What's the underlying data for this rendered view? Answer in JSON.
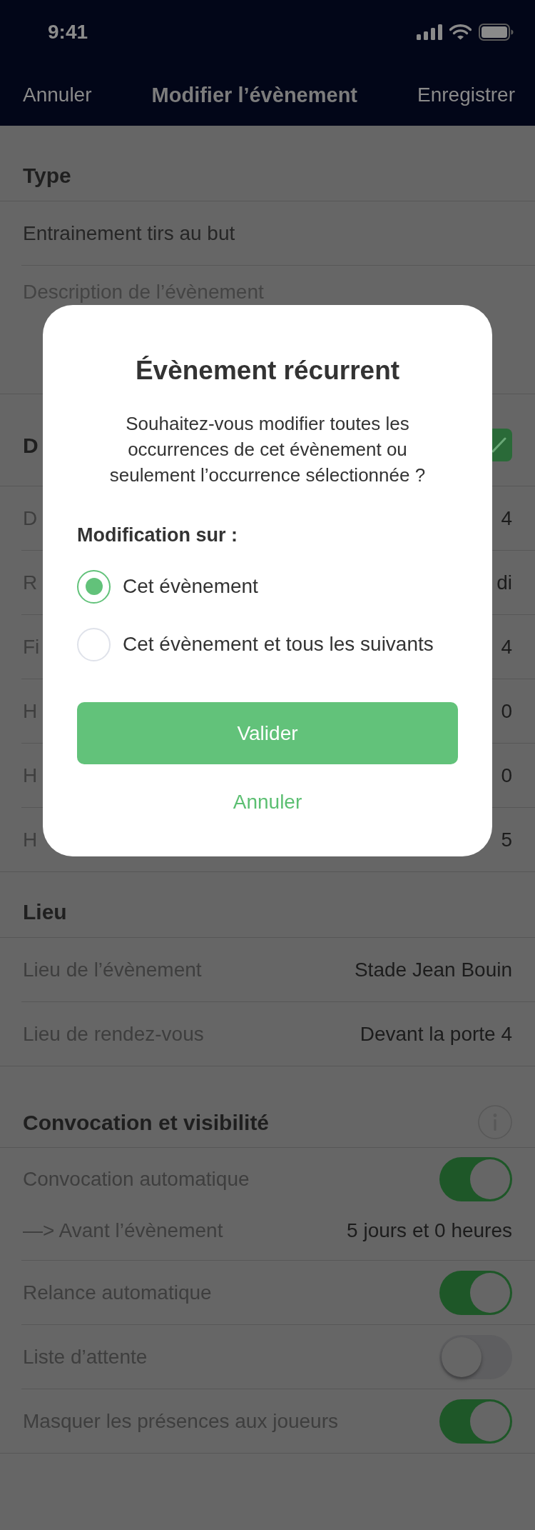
{
  "status_bar": {
    "time": "9:41"
  },
  "nav_bar": {
    "left_button": "Annuler",
    "title": "Modifier l’évènement",
    "right_button": "Enregistrer"
  },
  "sections": [
    {
      "kind": "plain",
      "title": "Type",
      "rows": [
        {
          "kind": "input",
          "value": "Entrainement tirs au but"
        },
        {
          "kind": "textarea",
          "placeholder": "Description de l’évènement"
        }
      ]
    },
    {
      "kind": "edit",
      "title": "D",
      "rows": [
        {
          "kind": "pair",
          "label": "D",
          "value": "4"
        },
        {
          "kind": "pair",
          "label": "R",
          "value": "di"
        },
        {
          "kind": "pair",
          "label": "Fi",
          "value": "4"
        },
        {
          "kind": "pair",
          "label": "H",
          "value": "0"
        },
        {
          "kind": "pair",
          "label": "H",
          "value": "0"
        },
        {
          "kind": "pair",
          "label": "H",
          "value": "5"
        }
      ]
    },
    {
      "kind": "plain",
      "title": "Lieu",
      "rows": [
        {
          "kind": "pair",
          "label": "Lieu de l’évènement",
          "value": "Stade Jean Bouin"
        },
        {
          "kind": "pair",
          "label": "Lieu de rendez-vous",
          "value": "Devant la porte 4"
        }
      ]
    },
    {
      "kind": "info",
      "title": "Convocation et visibilité",
      "rows": [
        {
          "kind": "toggle",
          "label": "Convocation automatique",
          "on": true,
          "detail": {
            "label": "—> Avant l’évènement",
            "value": "5 jours et 0 heures"
          }
        },
        {
          "kind": "toggle",
          "label": "Relance automatique",
          "on": true
        },
        {
          "kind": "toggle",
          "label": "Liste d’attente",
          "on": false
        },
        {
          "kind": "toggle",
          "label": "Masquer les présences aux joueurs",
          "on": true
        }
      ]
    }
  ],
  "dialog": {
    "title": "Évènement récurrent",
    "message": "Souhaitez-vous modifier toutes les occurrences de cet évènement ou seulement l’occurrence sélectionnée ?",
    "options_label": "Modification sur :",
    "options": [
      {
        "label": "Cet évènement",
        "selected": true
      },
      {
        "label": "Cet évènement et tous les suivants",
        "selected": false
      }
    ],
    "confirm": "Valider",
    "cancel": "Annuler"
  }
}
